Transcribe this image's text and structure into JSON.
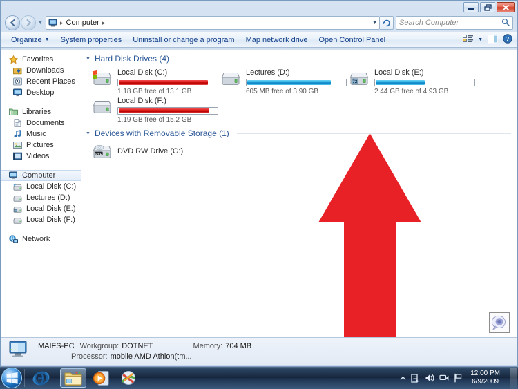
{
  "window": {
    "minimize_tooltip": "Minimize",
    "restore_tooltip": "Restore Down",
    "close_tooltip": "Close"
  },
  "address": {
    "back_tooltip": "Back",
    "forward_tooltip": "Forward",
    "crumb_root": "Computer",
    "separator": "▸",
    "refresh_tooltip": "Refresh"
  },
  "search": {
    "placeholder": "Search Computer",
    "value": ""
  },
  "toolbar": {
    "organize": "Organize",
    "caret": "▼",
    "system_properties": "System properties",
    "uninstall": "Uninstall or change a program",
    "map_drive": "Map network drive",
    "open_control_panel": "Open Control Panel",
    "views_tooltip": "Change your view",
    "preview_tooltip": "Show the preview pane",
    "help_tooltip": "Get help"
  },
  "sidebar": {
    "groups": [
      {
        "header": "Favorites",
        "items": [
          {
            "label": "Downloads",
            "icon": "downloads-icon"
          },
          {
            "label": "Recent Places",
            "icon": "recent-places-icon"
          },
          {
            "label": "Desktop",
            "icon": "desktop-icon"
          }
        ]
      },
      {
        "header": "Libraries",
        "items": [
          {
            "label": "Documents",
            "icon": "documents-icon"
          },
          {
            "label": "Music",
            "icon": "music-icon"
          },
          {
            "label": "Pictures",
            "icon": "pictures-icon"
          },
          {
            "label": "Videos",
            "icon": "videos-icon"
          }
        ]
      },
      {
        "header": "Computer",
        "items": [
          {
            "label": "Local Disk (C:)",
            "icon": "windows-drive-icon"
          },
          {
            "label": "Lectures (D:)",
            "icon": "drive-icon"
          },
          {
            "label": "Local Disk (E:)",
            "icon": "drive-icon"
          },
          {
            "label": "Local Disk (F:)",
            "icon": "drive-icon"
          }
        ]
      },
      {
        "header": "Network",
        "items": []
      }
    ]
  },
  "content": {
    "groups": [
      {
        "title": "Hard Disk Drives (4)",
        "collapse_glyph": "◢",
        "drives": [
          {
            "name": "Local Disk (C:)",
            "capacity_text": "1.18 GB free of 13.1 GB",
            "free": "1.18 GB",
            "total": "13.1 GB",
            "used_percent": 91,
            "bar_color": "red",
            "icon": "windows-drive-icon"
          },
          {
            "name": "Lectures (D:)",
            "capacity_text": "605 MB free of 3.90 GB",
            "free": "605 MB",
            "total": "3.90 GB",
            "used_percent": 85,
            "bar_color": "blue",
            "icon": "drive-icon"
          },
          {
            "name": "Local Disk (E:)",
            "capacity_text": "2.44 GB free of 4.93 GB",
            "free": "2.44 GB",
            "total": "4.93 GB",
            "used_percent": 50,
            "bar_color": "blue",
            "icon": "drive-72-icon"
          },
          {
            "name": "Local Disk (F:)",
            "capacity_text": "1.19 GB free of 15.2 GB",
            "free": "1.19 GB",
            "total": "15.2 GB",
            "used_percent": 92,
            "bar_color": "red",
            "icon": "drive-icon"
          }
        ]
      },
      {
        "title": "Devices with Removable Storage (1)",
        "collapse_glyph": "◢",
        "drives": [
          {
            "name": "DVD RW Drive (G:)",
            "capacity_text": "",
            "icon": "dvd-drive-icon"
          }
        ]
      }
    ]
  },
  "status": {
    "computer_name": "MAIFS-PC",
    "workgroup_label": "Workgroup:",
    "workgroup_value": "DOTNET",
    "memory_label": "Memory:",
    "memory_value": "704 MB",
    "processor_label": "Processor:",
    "processor_value": "mobile AMD Athlon(tm..."
  },
  "overlay": {
    "arrow_color": "#E82127",
    "arrow_direction": "up"
  },
  "taskbar": {
    "start_tooltip": "Start",
    "apps": [
      {
        "name": "internet-explorer",
        "active": false
      },
      {
        "name": "windows-explorer",
        "active": true
      },
      {
        "name": "windows-media-player",
        "active": false
      },
      {
        "name": "snagit-editor",
        "active": false
      }
    ],
    "tray": {
      "show_hidden": "▲",
      "icons": [
        "action-center-icon",
        "volume-icon",
        "network-icon",
        "flag-icon"
      ]
    },
    "clock_time": "12:00 PM",
    "clock_date": "6/9/2009",
    "show_desktop_tooltip": "Show desktop"
  }
}
